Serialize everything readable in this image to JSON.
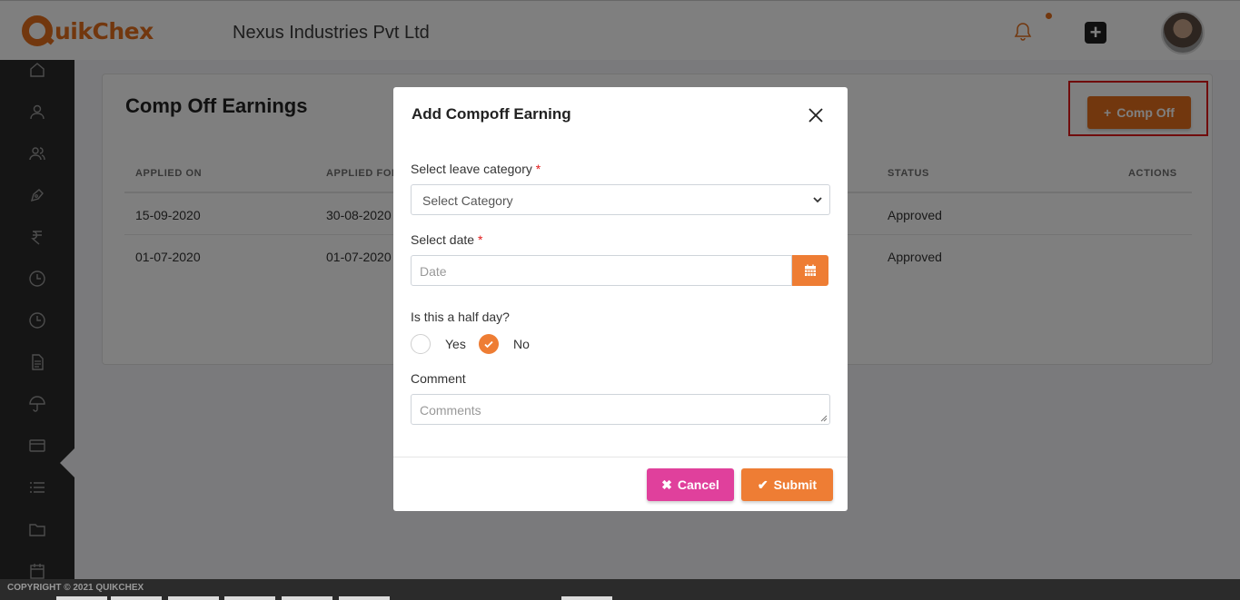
{
  "header": {
    "logo_text": "uikChex",
    "company_name": "Nexus Industries Pvt Ltd"
  },
  "sidebar": {
    "items": [
      "home-icon",
      "user-icon",
      "users-icon",
      "pen-icon",
      "rupee-icon",
      "clock-icon",
      "clock-icon",
      "document-icon",
      "umbrella-icon",
      "card-icon",
      "list-icon",
      "folder-icon",
      "calendar-icon"
    ],
    "active": "umbrella-icon"
  },
  "page": {
    "title": "Comp Off Earnings",
    "add_button": "Comp Off",
    "table": {
      "headers": [
        "APPLIED ON",
        "APPLIED FOR",
        "STATUS",
        "ACTIONS"
      ],
      "rows": [
        {
          "applied_on": "15-09-2020",
          "applied_for": "30-08-2020",
          "status": "Approved"
        },
        {
          "applied_on": "01-07-2020",
          "applied_for": "01-07-2020",
          "status": "Approved"
        }
      ]
    }
  },
  "modal": {
    "title": "Add Compoff Earning",
    "category_label": "Select leave category",
    "category_placeholder": "Select Category",
    "date_label": "Select date",
    "date_placeholder": "Date",
    "half_day_label": "Is this a half day?",
    "yes_label": "Yes",
    "no_label": "No",
    "selected": "No",
    "comment_label": "Comment",
    "comment_placeholder": "Comments",
    "cancel_label": "Cancel",
    "submit_label": "Submit",
    "required_mark": "*"
  },
  "footer": {
    "copyright": "COPYRIGHT © 2021 QUIKCHEX"
  },
  "colors": {
    "accent": "#e46f1c",
    "cancel": "#e0409c",
    "highlight": "#e01818"
  }
}
